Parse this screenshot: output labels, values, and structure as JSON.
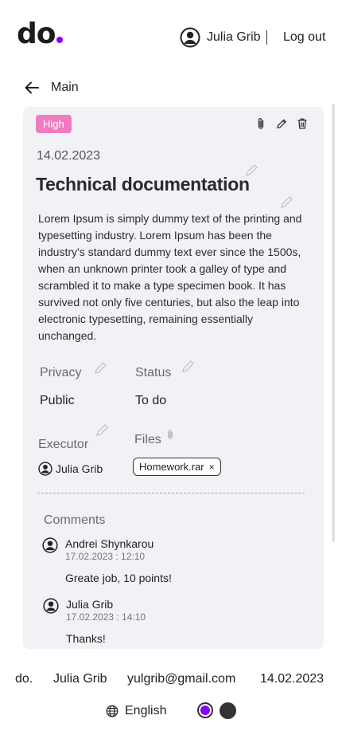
{
  "header": {
    "logo": "do",
    "user_name": "Julia Grib",
    "logout_label": "Log out"
  },
  "nav": {
    "back_label": "Main"
  },
  "task": {
    "priority": "High",
    "date": "14.02.2023",
    "title": "Technical documentation",
    "description": "Lorem Ipsum is simply dummy text of the printing and typesetting industry. Lorem Ipsum has been the industry's standard dummy text ever since the 1500s, when an unknown printer took a galley of type and scrambled it to make a type specimen book. It has survived not only five centuries, but also the leap into electronic typesetting, remaining essentially unchanged.",
    "privacy_label": "Privacy",
    "privacy_value": "Public",
    "status_label": "Status",
    "status_value": "To do",
    "executor_label": "Executor",
    "executor_name": "Julia Grib",
    "files_label": "Files",
    "file_name": "Homework.rar",
    "file_remove": "×"
  },
  "comments": {
    "label": "Comments",
    "items": [
      {
        "author": "Andrei Shynkarou",
        "time": "17.02.2023 : 12:10",
        "text": "Greate job, 10  points!"
      },
      {
        "author": "Julia Grib",
        "time": "17.02.2023 : 14:10",
        "text": "Thanks!"
      }
    ]
  },
  "footer": {
    "brand": "do.",
    "name": "Julia Grib",
    "email": "yulgrib@gmail.com",
    "date": "14.02.2023",
    "language": "English"
  },
  "colors": {
    "accent": "#8a00ff",
    "badge": "#f27bc0",
    "card": "#f1f2f6"
  },
  "icons": [
    "user-icon",
    "arrow-left-icon",
    "paperclip-icon",
    "pencil-icon",
    "trash-icon",
    "globe-icon"
  ]
}
